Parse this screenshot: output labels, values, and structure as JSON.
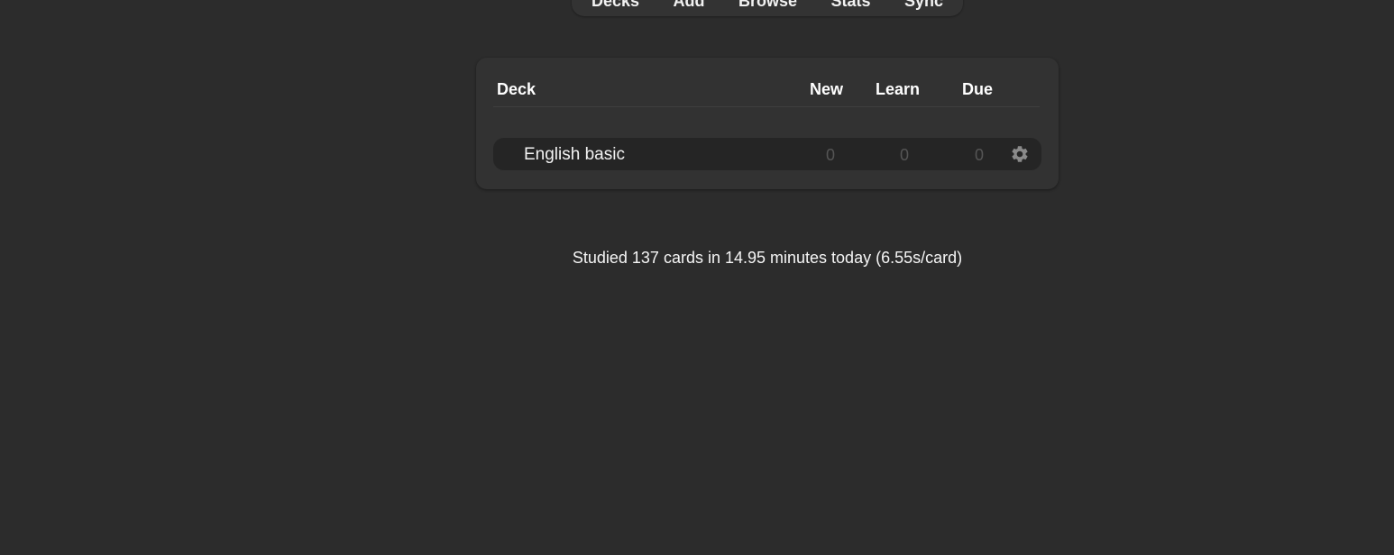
{
  "toolbar": {
    "items": [
      "Decks",
      "Add",
      "Browse",
      "Stats",
      "Sync"
    ]
  },
  "deck_table": {
    "headers": {
      "deck": "Deck",
      "new": "New",
      "learn": "Learn",
      "due": "Due"
    },
    "rows": [
      {
        "name": "English basic",
        "new": "0",
        "learn": "0",
        "due": "0",
        "options_icon": "gear-icon"
      }
    ]
  },
  "study_stats": "Studied 137 cards in 14.95 minutes today (6.55s/card)",
  "colors": {
    "background": "#2c2c2c",
    "card": "#323232",
    "row": "#252525",
    "zero_count": "#555555",
    "gear": "#8a8a8a"
  }
}
